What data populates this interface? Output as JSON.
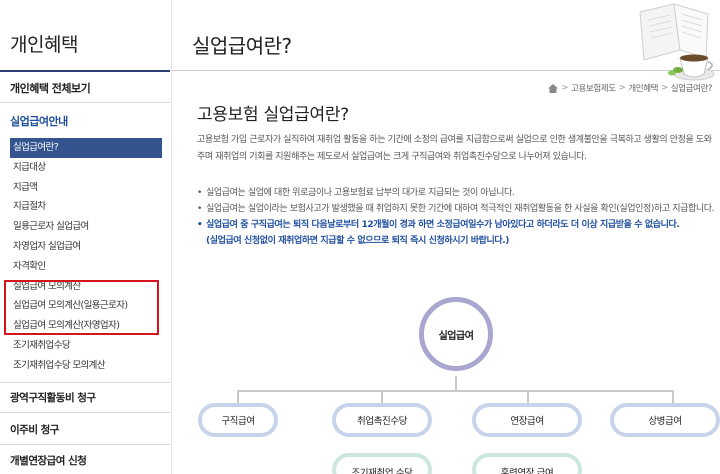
{
  "sidebar": {
    "title": "개인혜택",
    "menu_top": "개인혜택 전체보기",
    "section": "실업급여안내",
    "items": [
      {
        "label": "실업급여란?"
      },
      {
        "label": "지급대상"
      },
      {
        "label": "지급액"
      },
      {
        "label": "지급절차"
      },
      {
        "label": "일용근로자 실업급여"
      },
      {
        "label": "자영업자 실업급여"
      },
      {
        "label": "자격확인"
      },
      {
        "label": "실업급여 모의계산"
      },
      {
        "label": "실업급여 모의계산(일용근로자)"
      },
      {
        "label": "실업급여 모의계산(자영업자)"
      },
      {
        "label": "조기재취업수당"
      },
      {
        "label": "조기재취업수당 모의계산"
      }
    ],
    "lower": [
      {
        "label": "광역구직활동비 청구"
      },
      {
        "label": "이주비 청구"
      },
      {
        "label": "개별연장급여 신청"
      }
    ]
  },
  "header": {
    "title": "실업급여란?"
  },
  "breadcrumb": [
    "고용보험제도",
    "개인혜택",
    "실업급여란?"
  ],
  "content": {
    "section_title": "고용보험 실업급여란?",
    "intro": "고용보험 가입 근로자가 실직하여 재취업 활동을 하는 기간에 소정의 급여를 지급함으로써 실업으로 인한 생계불안을 극복하고 생활의 안정을 도와주며 재취업의 기회를 지원해주는 제도로서 실업급여는 크게 구직급여와 취업촉진수당으로 나누어져 있습니다.",
    "bullets": [
      "실업급여는 실업에 대한 위로금이나 고용보험료 납부의 대가로 지급되는 것이 아닙니다.",
      "실업급여는 실업이라는 보험사고가 발생했을 때 취업하지 못한 기간에 대하여 적극적인 재취업활동을 한 사실을 확인(실업인정)하고 지급합니다.",
      "실업급여 중 구직급여는 퇴직 다음날로부터 12개월이 경과 하면 소정급여일수가 남아있다고 하더라도 더 이상 지급받을 수 없습니다."
    ],
    "note": "(실업급여 신청없이 재취업하면 지급할 수 없으므로 퇴직 즉시 신청하시기 바랍니다.)"
  },
  "diagram": {
    "center": "실업급여",
    "level1": [
      "구직급여",
      "취업촉진수당",
      "연장급여",
      "상병급여"
    ],
    "level2": [
      "조기재취업 수당",
      "훈련연장 급여"
    ]
  }
}
